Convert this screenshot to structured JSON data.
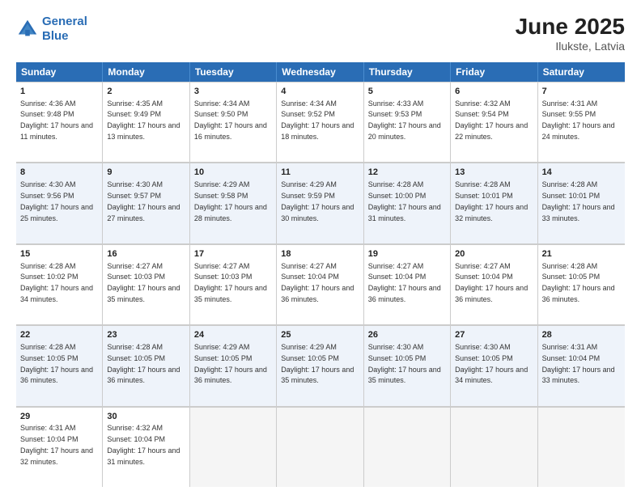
{
  "header": {
    "logo_line1": "General",
    "logo_line2": "Blue",
    "month_title": "June 2025",
    "location": "Ilukste, Latvia"
  },
  "days_of_week": [
    "Sunday",
    "Monday",
    "Tuesday",
    "Wednesday",
    "Thursday",
    "Friday",
    "Saturday"
  ],
  "weeks": [
    [
      {
        "day": "1",
        "sunrise": "Sunrise: 4:36 AM",
        "sunset": "Sunset: 9:48 PM",
        "daylight": "Daylight: 17 hours and 11 minutes."
      },
      {
        "day": "2",
        "sunrise": "Sunrise: 4:35 AM",
        "sunset": "Sunset: 9:49 PM",
        "daylight": "Daylight: 17 hours and 13 minutes."
      },
      {
        "day": "3",
        "sunrise": "Sunrise: 4:34 AM",
        "sunset": "Sunset: 9:50 PM",
        "daylight": "Daylight: 17 hours and 16 minutes."
      },
      {
        "day": "4",
        "sunrise": "Sunrise: 4:34 AM",
        "sunset": "Sunset: 9:52 PM",
        "daylight": "Daylight: 17 hours and 18 minutes."
      },
      {
        "day": "5",
        "sunrise": "Sunrise: 4:33 AM",
        "sunset": "Sunset: 9:53 PM",
        "daylight": "Daylight: 17 hours and 20 minutes."
      },
      {
        "day": "6",
        "sunrise": "Sunrise: 4:32 AM",
        "sunset": "Sunset: 9:54 PM",
        "daylight": "Daylight: 17 hours and 22 minutes."
      },
      {
        "day": "7",
        "sunrise": "Sunrise: 4:31 AM",
        "sunset": "Sunset: 9:55 PM",
        "daylight": "Daylight: 17 hours and 24 minutes."
      }
    ],
    [
      {
        "day": "8",
        "sunrise": "Sunrise: 4:30 AM",
        "sunset": "Sunset: 9:56 PM",
        "daylight": "Daylight: 17 hours and 25 minutes."
      },
      {
        "day": "9",
        "sunrise": "Sunrise: 4:30 AM",
        "sunset": "Sunset: 9:57 PM",
        "daylight": "Daylight: 17 hours and 27 minutes."
      },
      {
        "day": "10",
        "sunrise": "Sunrise: 4:29 AM",
        "sunset": "Sunset: 9:58 PM",
        "daylight": "Daylight: 17 hours and 28 minutes."
      },
      {
        "day": "11",
        "sunrise": "Sunrise: 4:29 AM",
        "sunset": "Sunset: 9:59 PM",
        "daylight": "Daylight: 17 hours and 30 minutes."
      },
      {
        "day": "12",
        "sunrise": "Sunrise: 4:28 AM",
        "sunset": "Sunset: 10:00 PM",
        "daylight": "Daylight: 17 hours and 31 minutes."
      },
      {
        "day": "13",
        "sunrise": "Sunrise: 4:28 AM",
        "sunset": "Sunset: 10:01 PM",
        "daylight": "Daylight: 17 hours and 32 minutes."
      },
      {
        "day": "14",
        "sunrise": "Sunrise: 4:28 AM",
        "sunset": "Sunset: 10:01 PM",
        "daylight": "Daylight: 17 hours and 33 minutes."
      }
    ],
    [
      {
        "day": "15",
        "sunrise": "Sunrise: 4:28 AM",
        "sunset": "Sunset: 10:02 PM",
        "daylight": "Daylight: 17 hours and 34 minutes."
      },
      {
        "day": "16",
        "sunrise": "Sunrise: 4:27 AM",
        "sunset": "Sunset: 10:03 PM",
        "daylight": "Daylight: 17 hours and 35 minutes."
      },
      {
        "day": "17",
        "sunrise": "Sunrise: 4:27 AM",
        "sunset": "Sunset: 10:03 PM",
        "daylight": "Daylight: 17 hours and 35 minutes."
      },
      {
        "day": "18",
        "sunrise": "Sunrise: 4:27 AM",
        "sunset": "Sunset: 10:04 PM",
        "daylight": "Daylight: 17 hours and 36 minutes."
      },
      {
        "day": "19",
        "sunrise": "Sunrise: 4:27 AM",
        "sunset": "Sunset: 10:04 PM",
        "daylight": "Daylight: 17 hours and 36 minutes."
      },
      {
        "day": "20",
        "sunrise": "Sunrise: 4:27 AM",
        "sunset": "Sunset: 10:04 PM",
        "daylight": "Daylight: 17 hours and 36 minutes."
      },
      {
        "day": "21",
        "sunrise": "Sunrise: 4:28 AM",
        "sunset": "Sunset: 10:05 PM",
        "daylight": "Daylight: 17 hours and 36 minutes."
      }
    ],
    [
      {
        "day": "22",
        "sunrise": "Sunrise: 4:28 AM",
        "sunset": "Sunset: 10:05 PM",
        "daylight": "Daylight: 17 hours and 36 minutes."
      },
      {
        "day": "23",
        "sunrise": "Sunrise: 4:28 AM",
        "sunset": "Sunset: 10:05 PM",
        "daylight": "Daylight: 17 hours and 36 minutes."
      },
      {
        "day": "24",
        "sunrise": "Sunrise: 4:29 AM",
        "sunset": "Sunset: 10:05 PM",
        "daylight": "Daylight: 17 hours and 36 minutes."
      },
      {
        "day": "25",
        "sunrise": "Sunrise: 4:29 AM",
        "sunset": "Sunset: 10:05 PM",
        "daylight": "Daylight: 17 hours and 35 minutes."
      },
      {
        "day": "26",
        "sunrise": "Sunrise: 4:30 AM",
        "sunset": "Sunset: 10:05 PM",
        "daylight": "Daylight: 17 hours and 35 minutes."
      },
      {
        "day": "27",
        "sunrise": "Sunrise: 4:30 AM",
        "sunset": "Sunset: 10:05 PM",
        "daylight": "Daylight: 17 hours and 34 minutes."
      },
      {
        "day": "28",
        "sunrise": "Sunrise: 4:31 AM",
        "sunset": "Sunset: 10:04 PM",
        "daylight": "Daylight: 17 hours and 33 minutes."
      }
    ],
    [
      {
        "day": "29",
        "sunrise": "Sunrise: 4:31 AM",
        "sunset": "Sunset: 10:04 PM",
        "daylight": "Daylight: 17 hours and 32 minutes."
      },
      {
        "day": "30",
        "sunrise": "Sunrise: 4:32 AM",
        "sunset": "Sunset: 10:04 PM",
        "daylight": "Daylight: 17 hours and 31 minutes."
      },
      {
        "day": "",
        "sunrise": "",
        "sunset": "",
        "daylight": ""
      },
      {
        "day": "",
        "sunrise": "",
        "sunset": "",
        "daylight": ""
      },
      {
        "day": "",
        "sunrise": "",
        "sunset": "",
        "daylight": ""
      },
      {
        "day": "",
        "sunrise": "",
        "sunset": "",
        "daylight": ""
      },
      {
        "day": "",
        "sunrise": "",
        "sunset": "",
        "daylight": ""
      }
    ]
  ]
}
